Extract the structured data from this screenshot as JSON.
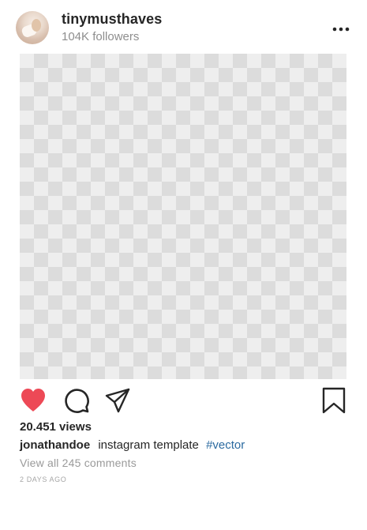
{
  "post": {
    "username": "tinymusthaves",
    "followers": "104K followers",
    "views": "20.451 views",
    "author": "jonathandoe",
    "caption_text": "instagram template",
    "hashtag": "#vector",
    "view_comments": "View all 245 comments",
    "time": "2 DAYS AGO",
    "liked": true
  },
  "icons": {
    "like": "heart-icon",
    "comment": "comment-bubble-icon",
    "share": "paper-plane-icon",
    "save": "bookmark-icon",
    "more": "more-dots-icon"
  },
  "colors": {
    "like_red": "#ed4956",
    "hashtag_blue": "#2b6aa0",
    "muted_gray": "#8e8e8e"
  }
}
